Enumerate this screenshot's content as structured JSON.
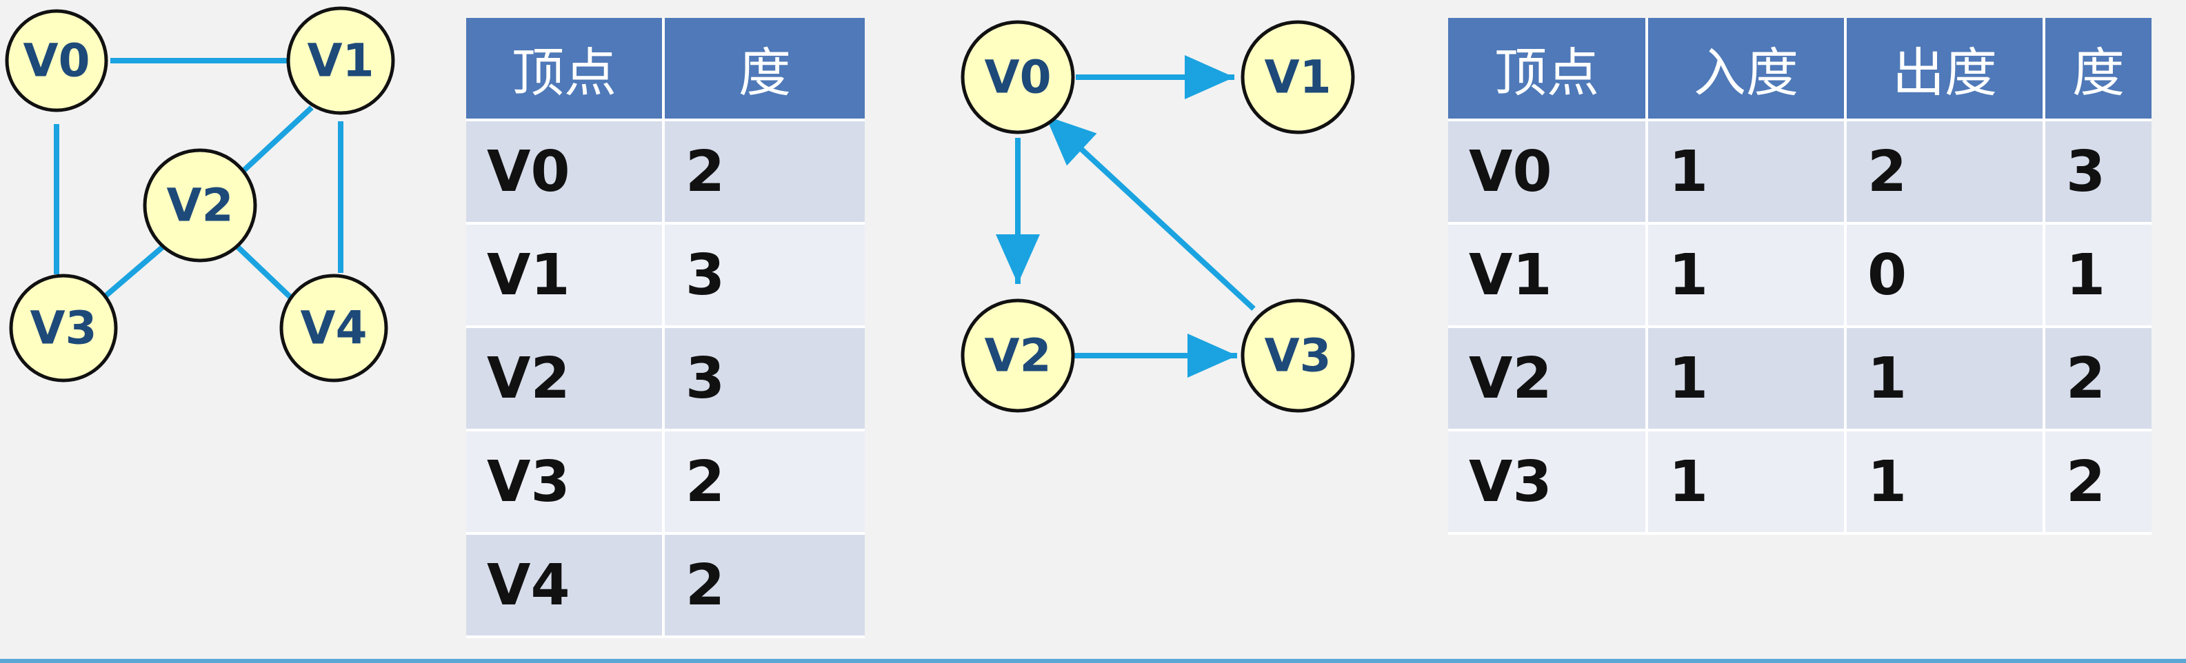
{
  "colors": {
    "edge": "#1aa3e0",
    "node_fill": "#ffffc2",
    "node_label": "#1e4a7a",
    "table_header": "#4f79b8",
    "row_dark": "#d6dcea",
    "row_light": "#ebeef5"
  },
  "graph1": {
    "type": "undirected",
    "nodes": [
      "V0",
      "V1",
      "V2",
      "V3",
      "V4"
    ],
    "edges": [
      [
        "V0",
        "V1"
      ],
      [
        "V0",
        "V3"
      ],
      [
        "V1",
        "V2"
      ],
      [
        "V1",
        "V4"
      ],
      [
        "V2",
        "V3"
      ],
      [
        "V2",
        "V4"
      ]
    ]
  },
  "table1": {
    "headers": [
      "顶点",
      "度"
    ],
    "rows": [
      [
        "V0",
        "2"
      ],
      [
        "V1",
        "3"
      ],
      [
        "V2",
        "3"
      ],
      [
        "V3",
        "2"
      ],
      [
        "V4",
        "2"
      ]
    ]
  },
  "graph2": {
    "type": "directed",
    "nodes": [
      "V0",
      "V1",
      "V2",
      "V3"
    ],
    "edges": [
      [
        "V0",
        "V1"
      ],
      [
        "V0",
        "V2"
      ],
      [
        "V2",
        "V3"
      ],
      [
        "V3",
        "V0"
      ]
    ]
  },
  "table2": {
    "headers": [
      "顶点",
      "入度",
      "出度",
      "度"
    ],
    "rows": [
      [
        "V0",
        "1",
        "2",
        "3"
      ],
      [
        "V1",
        "1",
        "0",
        "1"
      ],
      [
        "V2",
        "1",
        "1",
        "2"
      ],
      [
        "V3",
        "1",
        "1",
        "2"
      ]
    ]
  }
}
